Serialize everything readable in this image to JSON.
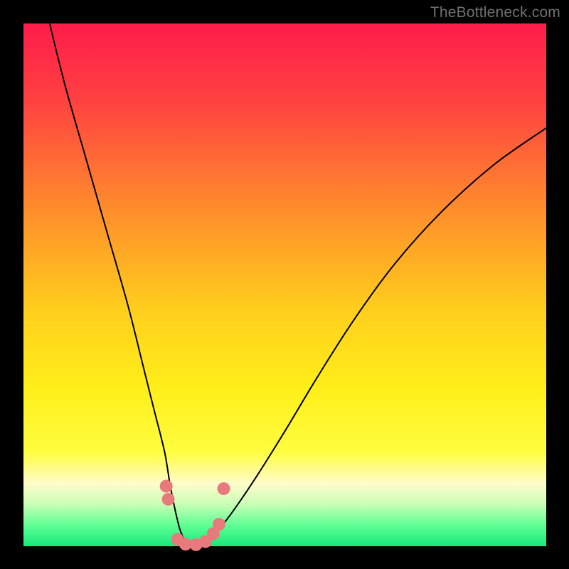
{
  "watermark": "TheBottleneck.com",
  "chart_data": {
    "type": "line",
    "title": "",
    "xlabel": "",
    "ylabel": "",
    "xlim": [
      0,
      100
    ],
    "ylim": [
      0,
      100
    ],
    "background": {
      "type": "vertical-gradient",
      "stops": [
        {
          "offset": 0,
          "color": "#ff1c4b"
        },
        {
          "offset": 15,
          "color": "#ff4240"
        },
        {
          "offset": 35,
          "color": "#ff8b2c"
        },
        {
          "offset": 55,
          "color": "#ffcf1c"
        },
        {
          "offset": 70,
          "color": "#ffef1a"
        },
        {
          "offset": 82,
          "color": "#fffd40"
        },
        {
          "offset": 88,
          "color": "#fffccb"
        },
        {
          "offset": 92,
          "color": "#c8ffb5"
        },
        {
          "offset": 96,
          "color": "#5eff94"
        },
        {
          "offset": 100,
          "color": "#17e87b"
        }
      ]
    },
    "series": [
      {
        "name": "bottleneck-curve",
        "color": "#000000",
        "stroke_width": 2,
        "x": [
          5,
          8,
          12,
          16,
          20,
          23,
          25,
          27,
          28,
          29,
          30,
          31,
          32,
          33,
          34,
          36,
          38,
          41,
          45,
          50,
          56,
          63,
          71,
          80,
          90,
          100
        ],
        "y": [
          100,
          88,
          74,
          60,
          46,
          34,
          26,
          18,
          12,
          7,
          3,
          1,
          0,
          0,
          1,
          2,
          4,
          8,
          14,
          22,
          32,
          43,
          54,
          64,
          73,
          80
        ]
      }
    ],
    "markers": {
      "color": "#e87a7d",
      "radius": 9,
      "points": [
        {
          "x": 27.3,
          "y": 11.5
        },
        {
          "x": 27.7,
          "y": 9.0
        },
        {
          "x": 29.5,
          "y": 1.3
        },
        {
          "x": 31.0,
          "y": 0.4
        },
        {
          "x": 33.0,
          "y": 0.3
        },
        {
          "x": 34.8,
          "y": 0.9
        },
        {
          "x": 36.3,
          "y": 2.4
        },
        {
          "x": 37.4,
          "y": 4.2
        },
        {
          "x": 38.3,
          "y": 11.0
        }
      ]
    },
    "frame": {
      "inner_left": 33,
      "inner_top": 33,
      "inner_width": 735,
      "inner_height": 735,
      "border_color": "#000000"
    }
  }
}
